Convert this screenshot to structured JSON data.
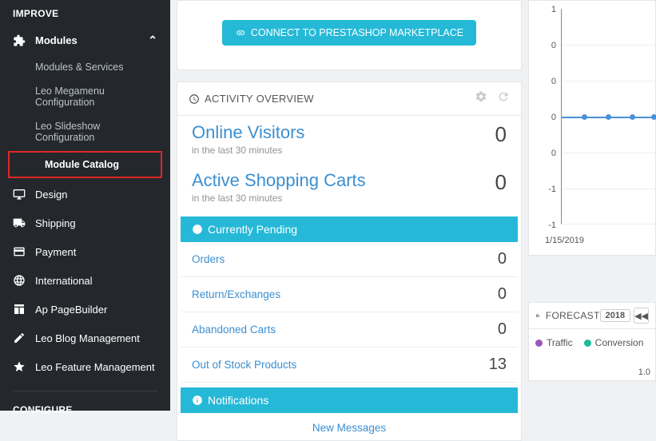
{
  "sidebar": {
    "section1": "IMPROVE",
    "section2": "CONFIGURE",
    "modules": {
      "label": "Modules",
      "sub": [
        "Modules & Services",
        "Leo Megamenu Configuration",
        "Leo Slideshow Configuration",
        "Module Catalog"
      ]
    },
    "items": [
      "Design",
      "Shipping",
      "Payment",
      "International",
      "Ap PageBuilder",
      "Leo Blog Management",
      "Leo Feature Management"
    ]
  },
  "connect_btn": "CONNECT TO PRESTASHOP MARKETPLACE",
  "activity": {
    "title": "ACTIVITY OVERVIEW",
    "visitors": {
      "label": "Online Visitors",
      "sub": "in the last 30 minutes",
      "value": "0"
    },
    "carts": {
      "label": "Active Shopping Carts",
      "sub": "in the last 30 minutes",
      "value": "0"
    },
    "pending": {
      "title": "Currently Pending",
      "rows": [
        {
          "label": "Orders",
          "value": "0"
        },
        {
          "label": "Return/Exchanges",
          "value": "0"
        },
        {
          "label": "Abandoned Carts",
          "value": "0"
        },
        {
          "label": "Out of Stock Products",
          "value": "13"
        }
      ]
    },
    "notifications": {
      "title": "Notifications",
      "rows": [
        "New Messages"
      ]
    }
  },
  "chart_data": {
    "type": "line",
    "x": [
      "1/15/2019"
    ],
    "series": [
      {
        "name": "",
        "values": [
          0,
          0,
          0,
          0,
          0,
          0,
          0,
          0
        ]
      }
    ],
    "ylim": [
      -1,
      1
    ],
    "yticks": [
      1,
      0,
      0,
      0,
      0,
      -1,
      -1
    ],
    "xlabel": "1/15/2019"
  },
  "forecast": {
    "title": "FORECAST",
    "year": "2018",
    "legend": [
      "Traffic",
      "Conversion"
    ],
    "axis_num": "1.0"
  }
}
